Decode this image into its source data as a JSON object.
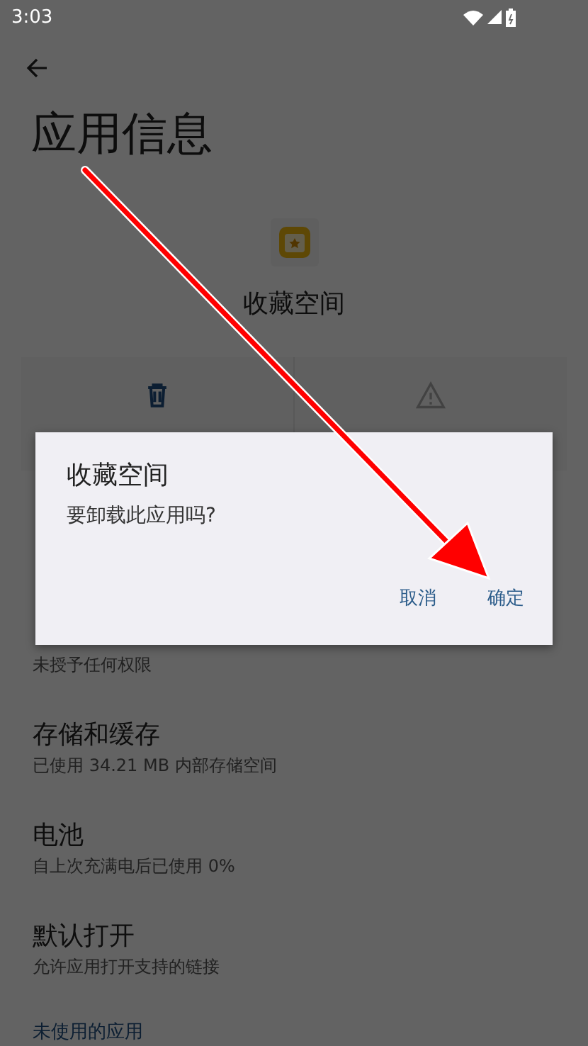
{
  "status_bar": {
    "time": "3:03"
  },
  "title": "应用信息",
  "app": {
    "name": "收藏空间"
  },
  "actions": [
    {
      "kind": "trash",
      "disabled": false
    },
    {
      "kind": "warning",
      "disabled": true
    }
  ],
  "settings": [
    {
      "subtitle": "未授予任何权限"
    },
    {
      "title": "存储和缓存",
      "subtitle": "已使用 34.21 MB 内部存储空间"
    },
    {
      "title": "电池",
      "subtitle": "自上次充满电后已使用 0%"
    },
    {
      "title": "默认打开",
      "subtitle": "允许应用打开支持的链接"
    }
  ],
  "section_header": "未使用的应用",
  "dialog": {
    "title": "收藏空间",
    "message": "要卸载此应用吗?",
    "buttons": [
      "取消",
      "确定"
    ]
  }
}
